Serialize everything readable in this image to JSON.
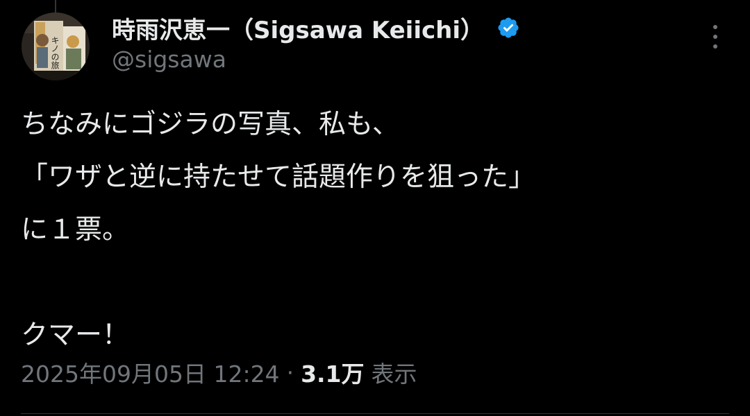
{
  "tweet": {
    "author": {
      "display_name": "時雨沢恵一（Sigsawa Keiichi）",
      "handle": "@sigsawa",
      "verified": true,
      "avatar_title": "キノの旅"
    },
    "body_lines": [
      "ちなみにゴジラの写真、私も、",
      "「ワザと逆に持たせて話題作りを狙った」",
      "に１票。",
      "",
      "クマー！"
    ],
    "timestamp": "2025年09月05日 12:24",
    "separator": "·",
    "views_count": "3.1万",
    "views_label": "表示"
  },
  "colors": {
    "background": "#000000",
    "primary_text": "#e7e9ea",
    "secondary_text": "#71767b",
    "verified_badge": "#1d9bf0"
  },
  "icons": {
    "verified": "verified-badge-icon",
    "more": "more-options-icon"
  }
}
